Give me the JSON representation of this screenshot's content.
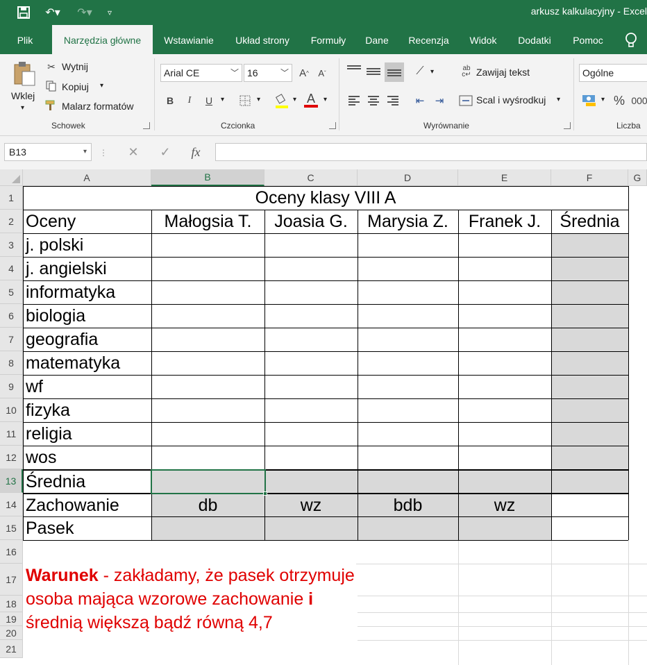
{
  "app": {
    "title": "arkusz kalkulacyjny - Excel"
  },
  "tabs": [
    "Plik",
    "Narzędzia główne",
    "Wstawianie",
    "Układ strony",
    "Formuły",
    "Dane",
    "Recenzja",
    "Widok",
    "Dodatki",
    "Pomoc"
  ],
  "ribbon": {
    "clipboard": {
      "paste": "Wklej",
      "cut": "Wytnij",
      "copy": "Kopiuj",
      "painter": "Malarz formatów",
      "label": "Schowek"
    },
    "font": {
      "name": "Arial CE",
      "size": "16",
      "bold": "B",
      "italic": "I",
      "underline": "U",
      "label": "Czcionka"
    },
    "alignment": {
      "wrap": "Zawijaj tekst",
      "merge": "Scal i wyśrodkuj",
      "label": "Wyrównanie"
    },
    "number": {
      "format": "Ogólne",
      "percent": "%",
      "label": "Liczba"
    }
  },
  "formula_bar": {
    "name_box": "B13",
    "fx": "fx",
    "value": ""
  },
  "sheet": {
    "columns": [
      "A",
      "B",
      "C",
      "D",
      "E",
      "F",
      "G"
    ],
    "rows": [
      "1",
      "2",
      "3",
      "4",
      "5",
      "6",
      "7",
      "8",
      "9",
      "10",
      "11",
      "12",
      "13",
      "14",
      "15",
      "16",
      "17",
      "18",
      "19",
      "20",
      "21"
    ],
    "title": "Oceny klasy VIII A",
    "header": [
      "Oceny",
      "Małogsia T.",
      "Joasia G.",
      "Marysia Z.",
      "Franek J.",
      "Średnia"
    ],
    "subjects": [
      "j. polski",
      "j. angielski",
      "informatyka",
      "biologia",
      "geografia",
      "matematyka",
      "wf",
      "fizyka",
      "religia",
      "wos"
    ],
    "avg_label": "Średnia",
    "behavior_label": "Zachowanie",
    "behavior": [
      "db",
      "wz",
      "bdb",
      "wz"
    ],
    "stripe_label": "Pasek",
    "note": {
      "bold1": "Warunek",
      "part1": " - zakładamy, że pasek otrzymuje osoba mająca wzorowe zachowanie ",
      "bold2": "i",
      "part2": "  średnią większą bądź równą 4,7"
    }
  },
  "colors": {
    "brand": "#217346",
    "note": "#e00000",
    "shade": "#d9d9d9"
  }
}
